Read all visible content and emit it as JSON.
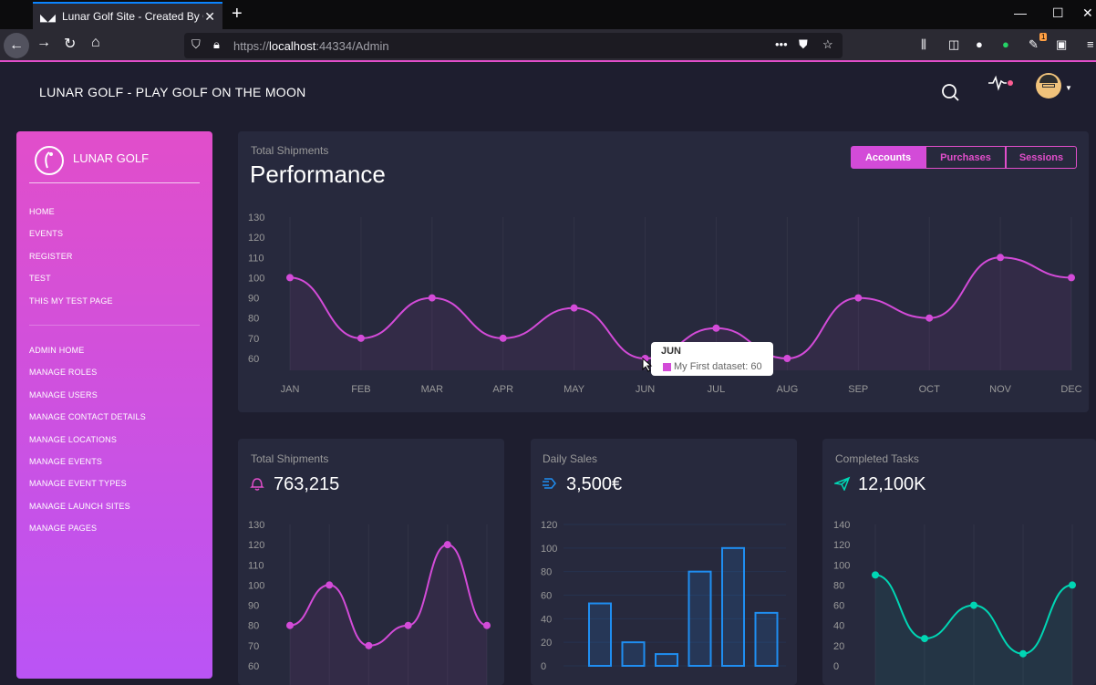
{
  "browser": {
    "tab_title": "Lunar Golf Site - Created By Ge",
    "close_glyph": "✕",
    "new_tab_glyph": "+",
    "url_prefix": "https://",
    "url_host": "localhost",
    "url_rest": ":44334/Admin",
    "notification_count": "1"
  },
  "app": {
    "title": "LUNAR GOLF - PLAY GOLF ON THE MOON"
  },
  "sidebar": {
    "logo_text": "LUNAR GOLF",
    "items": [
      {
        "label": "HOME"
      },
      {
        "label": "EVENTS"
      },
      {
        "label": "REGISTER"
      },
      {
        "label": "TEST"
      },
      {
        "label": "THIS MY TEST PAGE"
      }
    ],
    "admin_items": [
      {
        "label": "ADMIN HOME"
      },
      {
        "label": "MANAGE ROLES"
      },
      {
        "label": "MANAGE USERS"
      },
      {
        "label": "MANAGE CONTACT DETAILS"
      },
      {
        "label": "MANAGE LOCATIONS"
      },
      {
        "label": "MANAGE EVENTS"
      },
      {
        "label": "MANAGE EVENT TYPES"
      },
      {
        "label": "MANAGE LAUNCH SITES"
      },
      {
        "label": "MANAGE PAGES"
      }
    ]
  },
  "performance": {
    "category": "Total Shipments",
    "title": "Performance",
    "tabs": [
      "Accounts",
      "Purchases",
      "Sessions"
    ],
    "tooltip_title": "JUN",
    "tooltip_body": "My First dataset: 60"
  },
  "card_shipments": {
    "category": "Total Shipments",
    "value": "763,215"
  },
  "card_sales": {
    "category": "Daily Sales",
    "value": "3,500€"
  },
  "card_tasks": {
    "category": "Completed Tasks",
    "value": "12,100K"
  },
  "colors": {
    "pink": "#d34bd8",
    "blue": "#1f8ef1",
    "teal": "#00d6b4",
    "card": "#27293d",
    "bg": "#1e1e2f"
  },
  "chart_data": [
    {
      "type": "line",
      "title": "Performance",
      "categories": [
        "JAN",
        "FEB",
        "MAR",
        "APR",
        "MAY",
        "JUN",
        "JUL",
        "AUG",
        "SEP",
        "OCT",
        "NOV",
        "DEC"
      ],
      "series": [
        {
          "name": "My First dataset",
          "values": [
            100,
            70,
            90,
            70,
            85,
            60,
            75,
            60,
            90,
            80,
            110,
            100
          ]
        }
      ],
      "ylim": [
        60,
        130
      ],
      "yticks": [
        60,
        70,
        80,
        90,
        100,
        110,
        120,
        130
      ]
    },
    {
      "type": "line",
      "title": "Total Shipments",
      "values": [
        80,
        100,
        70,
        80,
        120,
        80
      ],
      "yticks": [
        60,
        70,
        80,
        90,
        100,
        110,
        120,
        130
      ]
    },
    {
      "type": "bar",
      "title": "Daily Sales",
      "values": [
        53,
        20,
        10,
        80,
        100,
        45
      ],
      "yticks": [
        0,
        20,
        40,
        60,
        80,
        100,
        120
      ]
    },
    {
      "type": "line",
      "title": "Completed Tasks",
      "values": [
        90,
        27,
        60,
        12,
        80
      ],
      "yticks": [
        0,
        20,
        40,
        60,
        80,
        100,
        120,
        140
      ]
    }
  ]
}
